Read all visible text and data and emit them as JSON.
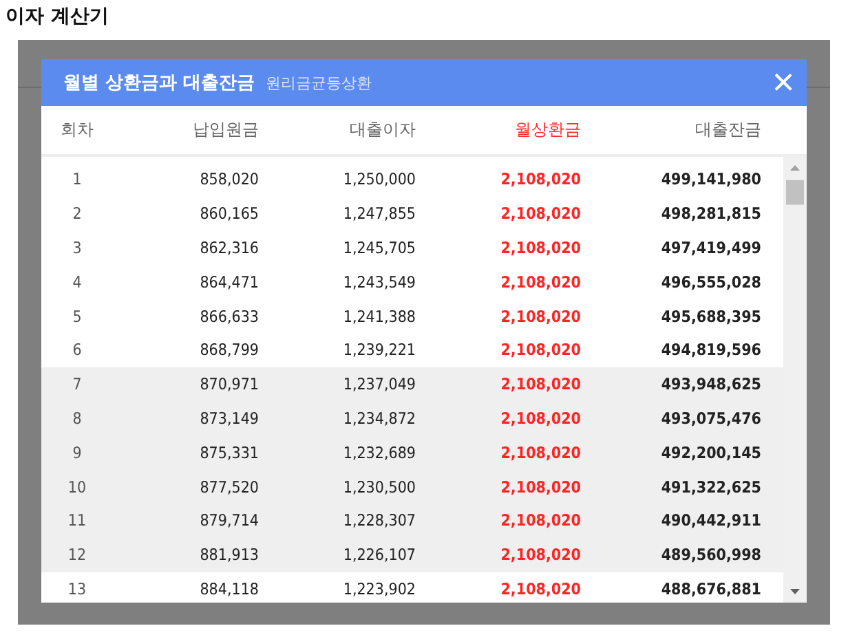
{
  "page": {
    "title": "이자 계산기"
  },
  "dialog": {
    "title": "월별 상환금과 대출잔금",
    "subtitle": "원리금균등상환",
    "close": "×",
    "columns": [
      {
        "label": "회차",
        "kind": "index"
      },
      {
        "label": "납입원금",
        "kind": "plain"
      },
      {
        "label": "대출이자",
        "kind": "plain"
      },
      {
        "label": "월상환금",
        "kind": "highlight"
      },
      {
        "label": "대출잔금",
        "kind": "bold"
      }
    ],
    "rows": [
      {
        "shaded": false,
        "cells": [
          "1",
          "858,020",
          "1,250,000",
          "2,108,020",
          "499,141,980"
        ]
      },
      {
        "shaded": false,
        "cells": [
          "2",
          "860,165",
          "1,247,855",
          "2,108,020",
          "498,281,815"
        ]
      },
      {
        "shaded": false,
        "cells": [
          "3",
          "862,316",
          "1,245,705",
          "2,108,020",
          "497,419,499"
        ]
      },
      {
        "shaded": false,
        "cells": [
          "4",
          "864,471",
          "1,243,549",
          "2,108,020",
          "496,555,028"
        ]
      },
      {
        "shaded": false,
        "cells": [
          "5",
          "866,633",
          "1,241,388",
          "2,108,020",
          "495,688,395"
        ]
      },
      {
        "shaded": false,
        "cells": [
          "6",
          "868,799",
          "1,239,221",
          "2,108,020",
          "494,819,596"
        ]
      },
      {
        "shaded": true,
        "cells": [
          "7",
          "870,971",
          "1,237,049",
          "2,108,020",
          "493,948,625"
        ]
      },
      {
        "shaded": true,
        "cells": [
          "8",
          "873,149",
          "1,234,872",
          "2,108,020",
          "493,075,476"
        ]
      },
      {
        "shaded": true,
        "cells": [
          "9",
          "875,331",
          "1,232,689",
          "2,108,020",
          "492,200,145"
        ]
      },
      {
        "shaded": true,
        "cells": [
          "10",
          "877,520",
          "1,230,500",
          "2,108,020",
          "491,322,625"
        ]
      },
      {
        "shaded": true,
        "cells": [
          "11",
          "879,714",
          "1,228,307",
          "2,108,020",
          "490,442,911"
        ]
      },
      {
        "shaded": true,
        "cells": [
          "12",
          "881,913",
          "1,226,107",
          "2,108,020",
          "489,560,998"
        ]
      },
      {
        "shaded": false,
        "cells": [
          "13",
          "884,118",
          "1,223,902",
          "2,108,020",
          "488,676,881"
        ]
      }
    ]
  }
}
